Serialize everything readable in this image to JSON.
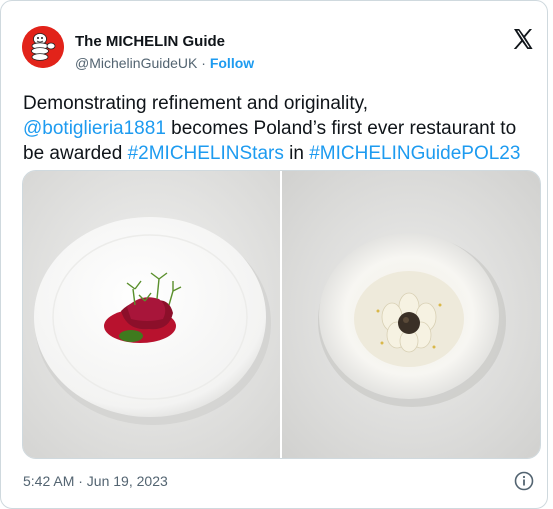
{
  "author": {
    "name": "The MICHELIN Guide",
    "handle": "@MichelinGuideUK",
    "separator": "·",
    "follow_label": "Follow",
    "avatar_icon": "michelin-man-icon"
  },
  "tweet": {
    "line1": "Demonstrating refinement and originality,",
    "mention": "@botiglieria1881",
    "text_mid": " becomes Poland’s first ever restaurant to be awarded ",
    "hashtag1": "#2MICHELINStars",
    "text_in": " in ",
    "hashtag2": "#MICHELINGuidePOL23"
  },
  "media": {
    "left_image": "beetroot-dish-photo",
    "right_image": "white-bowl-dessert-photo"
  },
  "footer": {
    "timestamp": "5:42 AM · Jun 19, 2023",
    "info_icon": "info-icon"
  },
  "colors": {
    "link": "#1d9bf0",
    "text": "#0f1419",
    "muted": "#536471",
    "avatar_bg": "#e2231a"
  }
}
